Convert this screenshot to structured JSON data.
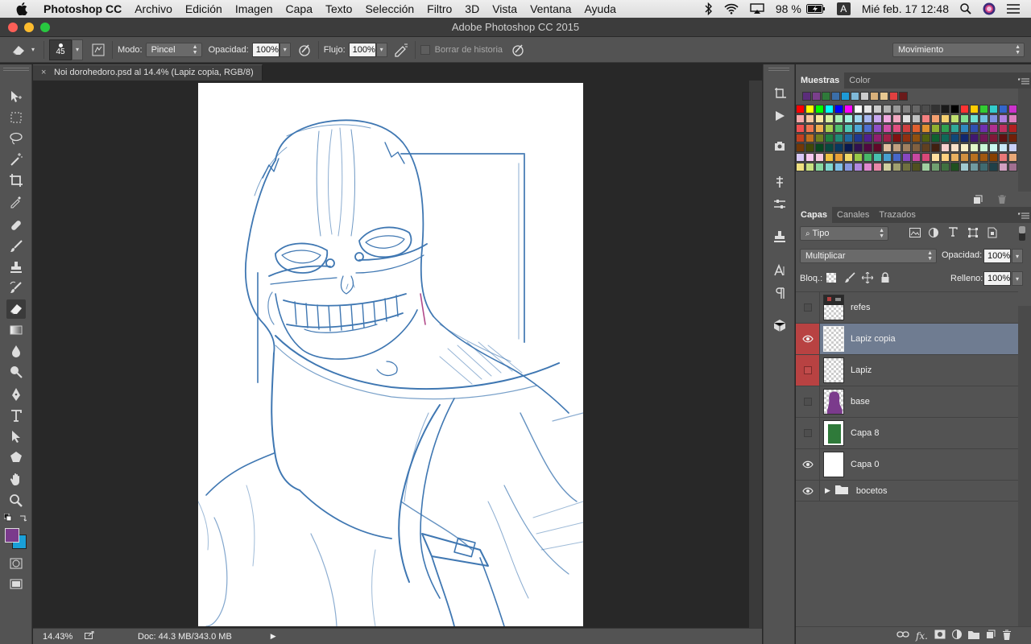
{
  "menubar": {
    "app_name": "Photoshop CC",
    "items": [
      "Archivo",
      "Edición",
      "Imagen",
      "Capa",
      "Texto",
      "Selección",
      "Filtro",
      "3D",
      "Vista",
      "Ventana",
      "Ayuda"
    ],
    "battery": "98 %",
    "input_source": "A",
    "datetime": "Mié feb. 17  12:48"
  },
  "window": {
    "title": "Adobe Photoshop CC 2015"
  },
  "options": {
    "brush_size": "45",
    "mode_label": "Modo:",
    "mode_value": "Pincel",
    "opacity_label": "Opacidad:",
    "opacity_value": "100%",
    "flow_label": "Flujo:",
    "flow_value": "100%",
    "erase_history_label": "Borrar de historia",
    "workspace_value": "Movimiento"
  },
  "document": {
    "tab_title": "Noi dorohedoro.psd al 14.4% (Lapiz copia, RGB/8)",
    "zoom": "14.43%",
    "doc_size": "Doc: 44.3 MB/343.0 MB"
  },
  "swatches_panel": {
    "tabs": [
      "Muestras",
      "Color"
    ],
    "recent": [
      "#5b2d7a",
      "#7a3f8c",
      "#2f7a3a",
      "#3b6ea8",
      "#1d9ad6",
      "#7fb9d8",
      "#cccccc",
      "#d8b07a",
      "#e8c890",
      "#e04040",
      "#6a1a1a"
    ],
    "grid": [
      "#ff0000",
      "#ffff00",
      "#00ff00",
      "#00ffff",
      "#0000ff",
      "#ff00ff",
      "#ffffff",
      "#e6e6e6",
      "#cccccc",
      "#b3b3b3",
      "#999999",
      "#808080",
      "#666666",
      "#4d4d4d",
      "#333333",
      "#1a1a1a",
      "#000000",
      "#ff3333",
      "#ffcc00",
      "#33cc33",
      "#33cccc",
      "#3366cc",
      "#cc33cc",
      "#f7a8a8",
      "#f7c7a0",
      "#f7e6a0",
      "#d8f0a0",
      "#a8f0b8",
      "#a0f0e0",
      "#a0d8f0",
      "#a8b8f0",
      "#c8a8f0",
      "#f0a8e0",
      "#f0a8c0",
      "#e0e0e0",
      "#c0c0c0",
      "#f48080",
      "#f4a070",
      "#f4d070",
      "#c0e070",
      "#80e090",
      "#70e0d0",
      "#70c0e0",
      "#8090e0",
      "#b080e0",
      "#e080c0",
      "#f05050",
      "#f07850",
      "#f0b050",
      "#a8d050",
      "#50c070",
      "#50c8b8",
      "#50a8d8",
      "#5070d0",
      "#9050c8",
      "#d050a8",
      "#e05080",
      "#d04040",
      "#e06030",
      "#e09030",
      "#90b030",
      "#30a050",
      "#30a898",
      "#3088c0",
      "#3050b0",
      "#7030b0",
      "#b03090",
      "#c03060",
      "#b02020",
      "#c04020",
      "#c07020",
      "#708020",
      "#208040",
      "#208878",
      "#2068a0",
      "#203890",
      "#502090",
      "#902070",
      "#a02048",
      "#801010",
      "#903010",
      "#905010",
      "#506010",
      "#106030",
      "#106858",
      "#104878",
      "#102870",
      "#401870",
      "#701858",
      "#801838",
      "#601010",
      "#702008",
      "#703808",
      "#404808",
      "#084820",
      "#084840",
      "#083860",
      "#081850",
      "#301050",
      "#500840",
      "#600828",
      "#e0c0a0",
      "#c0a080",
      "#a08060",
      "#806040",
      "#604020",
      "#402010",
      "#f8d0d0",
      "#f8e0c8",
      "#f8f0c8",
      "#e0f8c8",
      "#c8f8d8",
      "#c8f8f0",
      "#c8e8f8",
      "#c8d0f8",
      "#d8c8f8",
      "#f8c8f0",
      "#f8c8e0",
      "#f0c040",
      "#e8a038",
      "#f0d868",
      "#98c848",
      "#48b868",
      "#48c0b0",
      "#48a0d0",
      "#4868c8",
      "#8848c0",
      "#c848a0",
      "#d84878",
      "#ffe0a0",
      "#ffd080",
      "#e8b060",
      "#d09040",
      "#b87020",
      "#a05810",
      "#884000",
      "#e87878",
      "#e8a878",
      "#f0e080",
      "#c8e080",
      "#88d8a0",
      "#80d8d0",
      "#80c0e8",
      "#8898e0",
      "#b088e0",
      "#e088d0",
      "#e888a8",
      "#d0d0a0",
      "#a0a070",
      "#707040",
      "#505020",
      "#a0d0a0",
      "#70a070",
      "#407040",
      "#205020",
      "#a0c8d0",
      "#709aa0",
      "#406a70",
      "#204048",
      "#d0a0c0",
      "#a07090"
    ]
  },
  "layers_panel": {
    "tabs": [
      "Capas",
      "Canales",
      "Trazados"
    ],
    "filter_value": "Tipo",
    "blend_mode": "Multiplicar",
    "opacity_label": "Opacidad:",
    "opacity_value": "100%",
    "lock_label": "Bloq.:",
    "fill_label": "Relleno:",
    "fill_value": "100%",
    "layers": [
      {
        "name": "refes",
        "visible": false
      },
      {
        "name": "Lapiz copia",
        "visible": true,
        "selected": true
      },
      {
        "name": "Lapiz",
        "visible": false
      },
      {
        "name": "base",
        "visible": false
      },
      {
        "name": "Capa 8",
        "visible": false
      },
      {
        "name": "Capa 0",
        "visible": true
      }
    ],
    "group_name": "bocetos"
  },
  "colors": {
    "foreground": "#7b3b8c",
    "background": "#1aa0d8",
    "sketch_line": "#3f77b2",
    "selected_layer": "#6f7c91",
    "red_visibility": "#b84242"
  }
}
